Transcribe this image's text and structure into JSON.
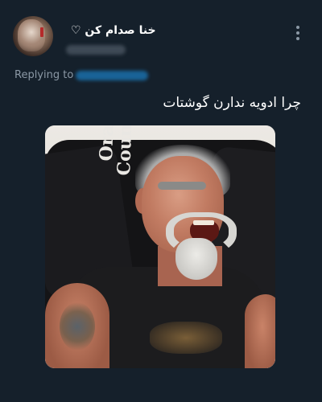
{
  "tweet": {
    "display_name": "خنا صدام کن ♡",
    "replying_to_label": "Replying to",
    "text": "چرا ادویه ندارن گوشتات"
  },
  "media": {
    "chair_print_line1": "Orange",
    "chair_print_line2": "County"
  },
  "colors": {
    "background": "#15202b",
    "secondary_text": "#8b98a5",
    "link": "#1d9bf0"
  }
}
